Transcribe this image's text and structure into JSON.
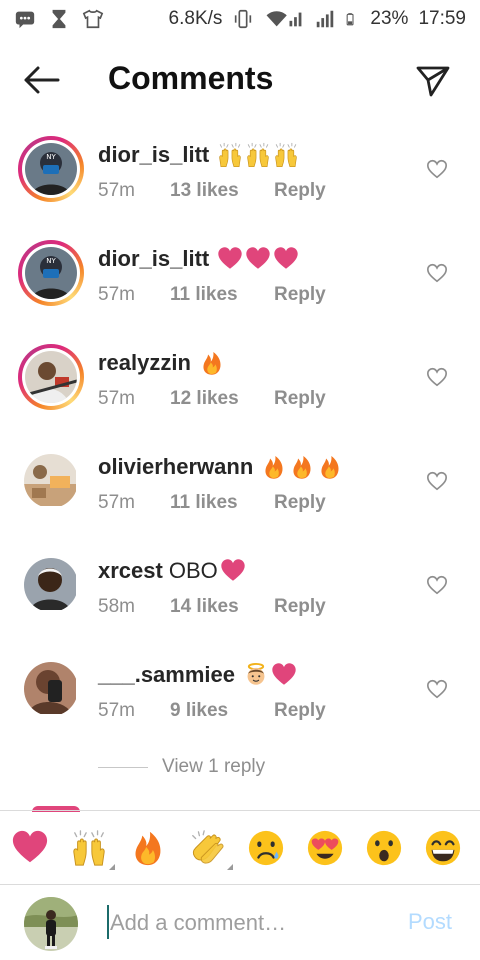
{
  "status_bar": {
    "net_speed": "6.8K/s",
    "battery": "23%",
    "time": "17:59"
  },
  "header": {
    "title": "Comments",
    "back_icon": "arrow-left-icon",
    "share_icon": "paper-plane-icon"
  },
  "comments": [
    {
      "username": "dior_is_litt",
      "time": "57m",
      "likes": "13 likes",
      "reply": "Reply",
      "text": "",
      "emojis": [
        "raised-hands",
        "raised-hands",
        "raised-hands"
      ],
      "story_ring": true
    },
    {
      "username": "dior_is_litt",
      "time": "57m",
      "likes": "11 likes",
      "reply": "Reply",
      "text": "",
      "emojis": [
        "pink-heart",
        "pink-heart",
        "pink-heart"
      ],
      "story_ring": true
    },
    {
      "username": "realyzzin",
      "time": "57m",
      "likes": "12 likes",
      "reply": "Reply",
      "text": "",
      "emojis": [
        "fire"
      ],
      "story_ring": true
    },
    {
      "username": "olivierherwann",
      "time": "57m",
      "likes": "11 likes",
      "reply": "Reply",
      "text": "",
      "emojis": [
        "fire",
        "fire",
        "fire"
      ],
      "story_ring": false
    },
    {
      "username": "xrcest",
      "time": "58m",
      "likes": "14 likes",
      "reply": "Reply",
      "text": "OBO",
      "emojis": [
        "pink-heart"
      ],
      "story_ring": false
    },
    {
      "username": "___.sammiee",
      "time": "57m",
      "likes": "9 likes",
      "reply": "Reply",
      "text": "",
      "emojis": [
        "baby-angel",
        "pink-heart"
      ],
      "story_ring": false
    }
  ],
  "view_replies": "View 1 reply",
  "emoji_bar": [
    "pink-heart",
    "raised-hands",
    "fire",
    "clapping-hands",
    "sad-face",
    "heart-eyes-face",
    "surprised-face",
    "grinning-face"
  ],
  "input": {
    "placeholder": "Add a comment…",
    "post_label": "Post"
  },
  "colors": {
    "accent_heart": "#e0457b",
    "post_disabled": "#b3dbff",
    "muted_text": "#8e8e8e"
  }
}
